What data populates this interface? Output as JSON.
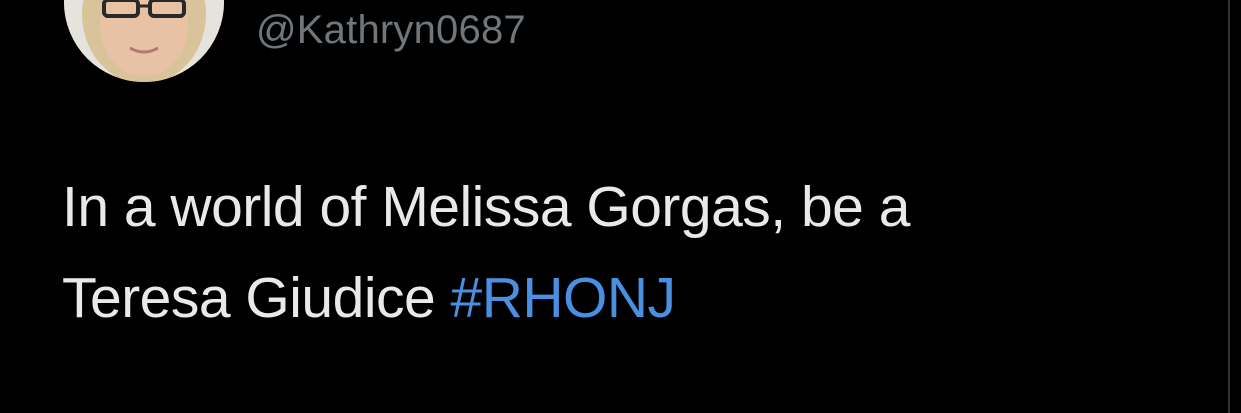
{
  "tweet": {
    "author_handle": "@Kathryn0687",
    "text_line_1": "In a world of Melissa Gorgas, be a",
    "text_line_2": "Teresa Giudice ",
    "hashtag": "#RHONJ"
  },
  "colors": {
    "background": "#000000",
    "text": "#e7e9ea",
    "muted": "#71767b",
    "link": "#4a90e2"
  },
  "icons": {
    "avatar": "profile-photo"
  }
}
